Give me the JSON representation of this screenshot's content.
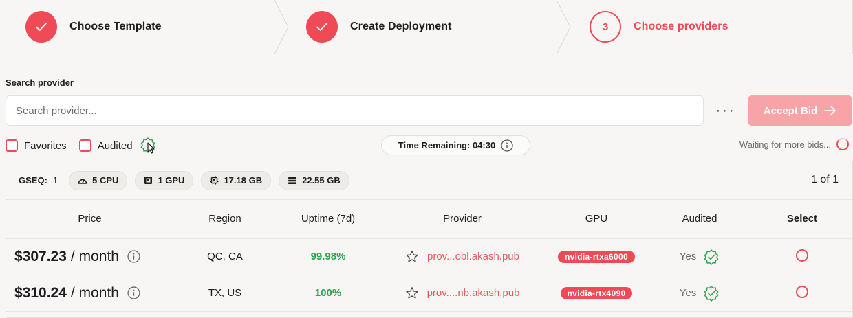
{
  "stepper": {
    "steps": [
      {
        "label": "Choose Template",
        "status": "done"
      },
      {
        "label": "Create Deployment",
        "status": "done"
      },
      {
        "label": "Choose providers",
        "status": "current",
        "number": "3"
      }
    ]
  },
  "search": {
    "label": "Search provider",
    "placeholder": "Search provider...",
    "value": ""
  },
  "actions": {
    "more_label": "···",
    "accept_label": "Accept Bid"
  },
  "filters": {
    "favorites_label": "Favorites",
    "audited_label": "Audited"
  },
  "timer": {
    "label": "Time Remaining:",
    "value": "04:30"
  },
  "status": {
    "waiting_text": "Waiting for more bids..."
  },
  "specs": {
    "gseq_label": "GSEQ:",
    "gseq_value": "1",
    "cpu": "5 CPU",
    "gpu": "1 GPU",
    "memory": "17.18 GB",
    "storage": "22.55 GB",
    "pager": "1 of 1"
  },
  "table": {
    "headers": [
      "Price",
      "Region",
      "Uptime (7d)",
      "Provider",
      "GPU",
      "Audited",
      "Select"
    ],
    "rows": [
      {
        "price": "$307.23",
        "period": "/ month",
        "region": "QC, CA",
        "uptime": "99.98%",
        "provider": "prov...obl.akash.pub",
        "gpu": "nvidia-rtxa6000",
        "audited": "Yes"
      },
      {
        "price": "$310.24",
        "period": "/ month",
        "region": "TX, US",
        "uptime": "100%",
        "provider": "prov....nb.akash.pub",
        "gpu": "nvidia-rtx4090",
        "audited": "Yes"
      }
    ]
  },
  "colors": {
    "accent": "#ef4a55",
    "accent_disabled": "#f8a3a8",
    "success": "#2ea44f",
    "background": "#f7f6f4"
  }
}
